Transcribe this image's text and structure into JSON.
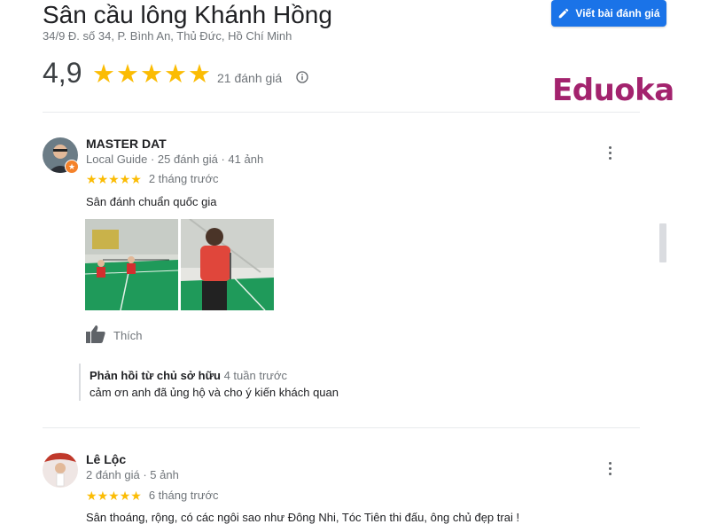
{
  "place": {
    "name": "Sân cầu lông Khánh Hồng",
    "address": "34/9 Đ. số 34, P. Bình An, Thủ Đức, Hồ Chí Minh",
    "rating": "4,9",
    "rating_value": 4.9,
    "review_count": "21 đánh giá"
  },
  "write_review_button": {
    "label": "Viết bài đánh giá",
    "icon": "pencil-icon"
  },
  "brand": {
    "text": "Eduoka",
    "color": "#a3236e"
  },
  "colors": {
    "star": "#fbbc04",
    "button": "#1a73e8",
    "badge": "#f5822a"
  },
  "reviews": [
    {
      "author": "MASTER DAT",
      "meta": "Local Guide · 25 đánh giá · 41 ảnh",
      "stars": 5,
      "when": "2 tháng trước",
      "text": "Sân đánh chuẩn quốc gia",
      "like_label": "Thích",
      "reply": {
        "title": "Phản hồi từ chủ sở hữu",
        "when": "4 tuần trước",
        "text": "cảm ơn anh đã ủng hộ và cho ý kiến khách quan"
      }
    },
    {
      "author": "Lê Lộc",
      "meta": "2 đánh giá · 5 ảnh",
      "stars": 5,
      "when": "6 tháng trước",
      "text": "Sân thoáng, rộng, có các ngôi sao như Đông Nhi, Tóc Tiên thi đấu, ông chủ đẹp trai !"
    }
  ]
}
